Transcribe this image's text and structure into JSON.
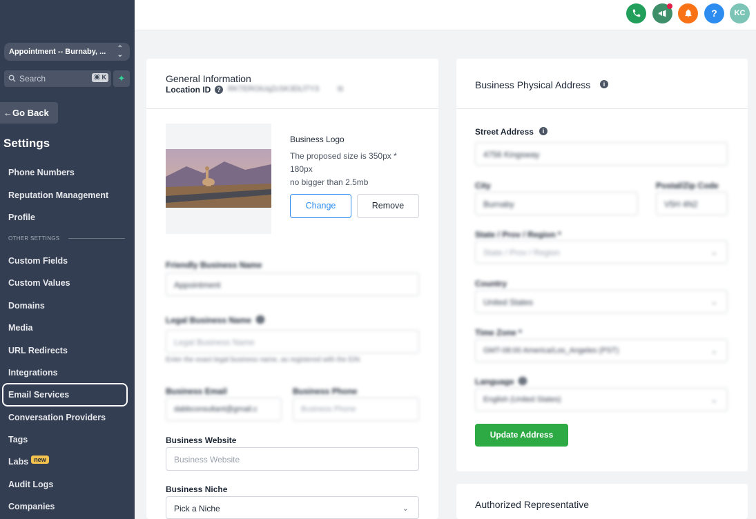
{
  "sidebar": {
    "location": "Appointment -- Burnaby, ...",
    "search_placeholder": "Search",
    "search_shortcut": "⌘ K",
    "go_back": "Go Back",
    "title": "Settings",
    "items_top": [
      "Phone Numbers",
      "Reputation Management",
      "Profile"
    ],
    "section_label": "OTHER SETTINGS",
    "items": [
      "Custom Fields",
      "Custom Values",
      "Domains",
      "Media",
      "URL Redirects",
      "Integrations",
      "Email Services",
      "Conversation Providers",
      "Tags",
      "Labs",
      "Audit Logs",
      "Companies"
    ],
    "labs_badge": "new",
    "active_item": "Email Services"
  },
  "topbar": {
    "avatar_initials": "KC",
    "colors": {
      "phone": "#22a05b",
      "megaphone": "#3f8f6b",
      "bell": "#f97316",
      "help": "#2d8cf0",
      "avatar": "#7cc4b5"
    }
  },
  "general": {
    "title": "General Information",
    "location_id_label": "Location ID",
    "location_id_value": "RKTEROiUqZcSK3DLf7Y3",
    "logo_title": "Business Logo",
    "logo_size_note_1": "The proposed size is 350px *",
    "logo_size_note_2": "180px",
    "logo_size_note_3": "no bigger than 2.5mb",
    "change_button": "Change",
    "remove_button": "Remove",
    "friendly_name_label": "Friendly Business Name",
    "friendly_name_value": "Appointment",
    "legal_name_label": "Legal Business Name",
    "legal_name_placeholder": "Legal Business Name",
    "legal_name_help": "Enter the exact legal business name, as registered with the EIN",
    "email_label": "Business Email",
    "email_value": "dabbconsultant@gmail.c",
    "phone_label": "Business Phone",
    "phone_placeholder": "Business Phone",
    "website_label": "Business Website",
    "website_placeholder": "Business Website",
    "niche_label": "Business Niche",
    "niche_value": "Pick a Niche"
  },
  "address": {
    "title": "Business Physical Address",
    "street_label": "Street Address",
    "street_value": "4756 Kingsway",
    "city_label": "City",
    "city_value": "Burnaby",
    "postal_label": "Postal/Zip Code",
    "postal_value": "V5H 4N2",
    "state_label": "State / Prov / Region *",
    "state_value": "State / Prov / Region",
    "country_label": "Country",
    "country_value": "United States",
    "timezone_label": "Time Zone *",
    "timezone_value": "GMT-08:00 America/Los_Angeles (PST)",
    "language_label": "Language",
    "language_value": "English (United States)",
    "update_button": "Update Address",
    "accent_color": "#2eaa44"
  },
  "representative": {
    "title": "Authorized Representative"
  }
}
